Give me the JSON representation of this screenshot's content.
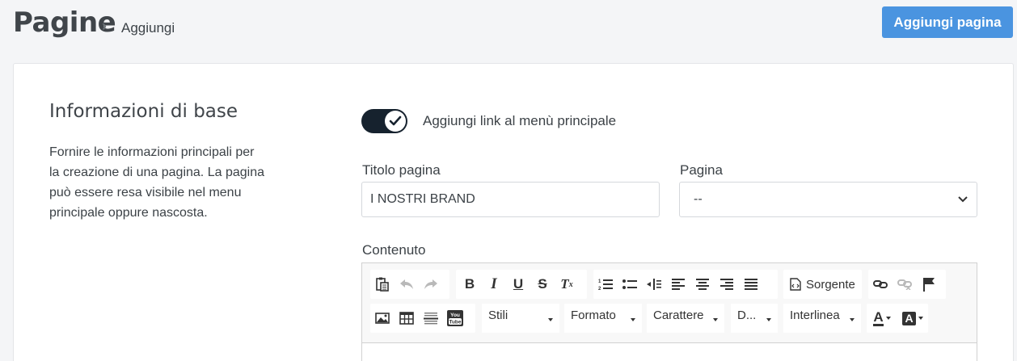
{
  "header": {
    "title": "Pagine",
    "breadcrumb": "Aggiungi",
    "add_button": "Aggiungi pagina"
  },
  "section": {
    "title": "Informazioni di base",
    "description": "Fornire le informazioni principali per la creazione di una pagina. La pagina può essere resa visibile nel menu principale oppure nascosta."
  },
  "form": {
    "toggle_label": "Aggiungi link al menù principale",
    "toggle_on": true,
    "title_label": "Titolo pagina",
    "title_value": "I NOSTRI BRAND",
    "page_label": "Pagina",
    "page_value": "--",
    "content_label": "Contenuto"
  },
  "editor": {
    "source_label": "Sorgente",
    "styles_label": "Stili",
    "format_label": "Formato",
    "font_label": "Carattere",
    "size_label": "D...",
    "lineheight_label": "Interlinea",
    "text_color_label": "A",
    "bg_color_label": "A"
  },
  "colors": {
    "accent": "#4a94e0",
    "toggle": "#16222e"
  }
}
